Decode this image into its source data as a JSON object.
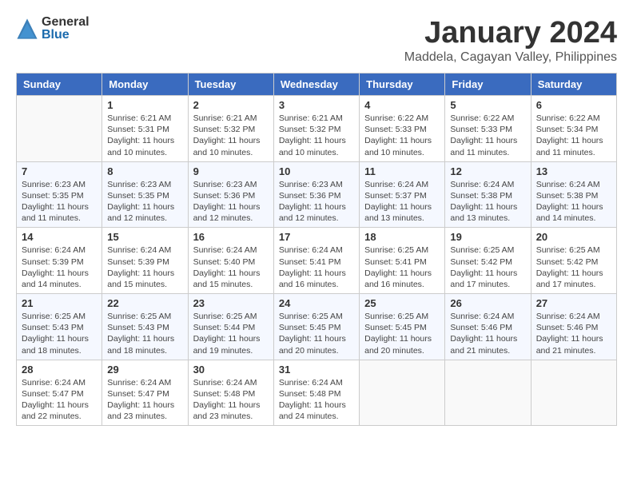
{
  "header": {
    "logo_general": "General",
    "logo_blue": "Blue",
    "month_title": "January 2024",
    "location": "Maddela, Cagayan Valley, Philippines"
  },
  "weekdays": [
    "Sunday",
    "Monday",
    "Tuesday",
    "Wednesday",
    "Thursday",
    "Friday",
    "Saturday"
  ],
  "weeks": [
    [
      {
        "day": "",
        "sunrise": "",
        "sunset": "",
        "daylight": ""
      },
      {
        "day": "1",
        "sunrise": "Sunrise: 6:21 AM",
        "sunset": "Sunset: 5:31 PM",
        "daylight": "Daylight: 11 hours and 10 minutes."
      },
      {
        "day": "2",
        "sunrise": "Sunrise: 6:21 AM",
        "sunset": "Sunset: 5:32 PM",
        "daylight": "Daylight: 11 hours and 10 minutes."
      },
      {
        "day": "3",
        "sunrise": "Sunrise: 6:21 AM",
        "sunset": "Sunset: 5:32 PM",
        "daylight": "Daylight: 11 hours and 10 minutes."
      },
      {
        "day": "4",
        "sunrise": "Sunrise: 6:22 AM",
        "sunset": "Sunset: 5:33 PM",
        "daylight": "Daylight: 11 hours and 10 minutes."
      },
      {
        "day": "5",
        "sunrise": "Sunrise: 6:22 AM",
        "sunset": "Sunset: 5:33 PM",
        "daylight": "Daylight: 11 hours and 11 minutes."
      },
      {
        "day": "6",
        "sunrise": "Sunrise: 6:22 AM",
        "sunset": "Sunset: 5:34 PM",
        "daylight": "Daylight: 11 hours and 11 minutes."
      }
    ],
    [
      {
        "day": "7",
        "sunrise": "Sunrise: 6:23 AM",
        "sunset": "Sunset: 5:35 PM",
        "daylight": "Daylight: 11 hours and 11 minutes."
      },
      {
        "day": "8",
        "sunrise": "Sunrise: 6:23 AM",
        "sunset": "Sunset: 5:35 PM",
        "daylight": "Daylight: 11 hours and 12 minutes."
      },
      {
        "day": "9",
        "sunrise": "Sunrise: 6:23 AM",
        "sunset": "Sunset: 5:36 PM",
        "daylight": "Daylight: 11 hours and 12 minutes."
      },
      {
        "day": "10",
        "sunrise": "Sunrise: 6:23 AM",
        "sunset": "Sunset: 5:36 PM",
        "daylight": "Daylight: 11 hours and 12 minutes."
      },
      {
        "day": "11",
        "sunrise": "Sunrise: 6:24 AM",
        "sunset": "Sunset: 5:37 PM",
        "daylight": "Daylight: 11 hours and 13 minutes."
      },
      {
        "day": "12",
        "sunrise": "Sunrise: 6:24 AM",
        "sunset": "Sunset: 5:38 PM",
        "daylight": "Daylight: 11 hours and 13 minutes."
      },
      {
        "day": "13",
        "sunrise": "Sunrise: 6:24 AM",
        "sunset": "Sunset: 5:38 PM",
        "daylight": "Daylight: 11 hours and 14 minutes."
      }
    ],
    [
      {
        "day": "14",
        "sunrise": "Sunrise: 6:24 AM",
        "sunset": "Sunset: 5:39 PM",
        "daylight": "Daylight: 11 hours and 14 minutes."
      },
      {
        "day": "15",
        "sunrise": "Sunrise: 6:24 AM",
        "sunset": "Sunset: 5:39 PM",
        "daylight": "Daylight: 11 hours and 15 minutes."
      },
      {
        "day": "16",
        "sunrise": "Sunrise: 6:24 AM",
        "sunset": "Sunset: 5:40 PM",
        "daylight": "Daylight: 11 hours and 15 minutes."
      },
      {
        "day": "17",
        "sunrise": "Sunrise: 6:24 AM",
        "sunset": "Sunset: 5:41 PM",
        "daylight": "Daylight: 11 hours and 16 minutes."
      },
      {
        "day": "18",
        "sunrise": "Sunrise: 6:25 AM",
        "sunset": "Sunset: 5:41 PM",
        "daylight": "Daylight: 11 hours and 16 minutes."
      },
      {
        "day": "19",
        "sunrise": "Sunrise: 6:25 AM",
        "sunset": "Sunset: 5:42 PM",
        "daylight": "Daylight: 11 hours and 17 minutes."
      },
      {
        "day": "20",
        "sunrise": "Sunrise: 6:25 AM",
        "sunset": "Sunset: 5:42 PM",
        "daylight": "Daylight: 11 hours and 17 minutes."
      }
    ],
    [
      {
        "day": "21",
        "sunrise": "Sunrise: 6:25 AM",
        "sunset": "Sunset: 5:43 PM",
        "daylight": "Daylight: 11 hours and 18 minutes."
      },
      {
        "day": "22",
        "sunrise": "Sunrise: 6:25 AM",
        "sunset": "Sunset: 5:43 PM",
        "daylight": "Daylight: 11 hours and 18 minutes."
      },
      {
        "day": "23",
        "sunrise": "Sunrise: 6:25 AM",
        "sunset": "Sunset: 5:44 PM",
        "daylight": "Daylight: 11 hours and 19 minutes."
      },
      {
        "day": "24",
        "sunrise": "Sunrise: 6:25 AM",
        "sunset": "Sunset: 5:45 PM",
        "daylight": "Daylight: 11 hours and 20 minutes."
      },
      {
        "day": "25",
        "sunrise": "Sunrise: 6:25 AM",
        "sunset": "Sunset: 5:45 PM",
        "daylight": "Daylight: 11 hours and 20 minutes."
      },
      {
        "day": "26",
        "sunrise": "Sunrise: 6:24 AM",
        "sunset": "Sunset: 5:46 PM",
        "daylight": "Daylight: 11 hours and 21 minutes."
      },
      {
        "day": "27",
        "sunrise": "Sunrise: 6:24 AM",
        "sunset": "Sunset: 5:46 PM",
        "daylight": "Daylight: 11 hours and 21 minutes."
      }
    ],
    [
      {
        "day": "28",
        "sunrise": "Sunrise: 6:24 AM",
        "sunset": "Sunset: 5:47 PM",
        "daylight": "Daylight: 11 hours and 22 minutes."
      },
      {
        "day": "29",
        "sunrise": "Sunrise: 6:24 AM",
        "sunset": "Sunset: 5:47 PM",
        "daylight": "Daylight: 11 hours and 23 minutes."
      },
      {
        "day": "30",
        "sunrise": "Sunrise: 6:24 AM",
        "sunset": "Sunset: 5:48 PM",
        "daylight": "Daylight: 11 hours and 23 minutes."
      },
      {
        "day": "31",
        "sunrise": "Sunrise: 6:24 AM",
        "sunset": "Sunset: 5:48 PM",
        "daylight": "Daylight: 11 hours and 24 minutes."
      },
      {
        "day": "",
        "sunrise": "",
        "sunset": "",
        "daylight": ""
      },
      {
        "day": "",
        "sunrise": "",
        "sunset": "",
        "daylight": ""
      },
      {
        "day": "",
        "sunrise": "",
        "sunset": "",
        "daylight": ""
      }
    ]
  ]
}
